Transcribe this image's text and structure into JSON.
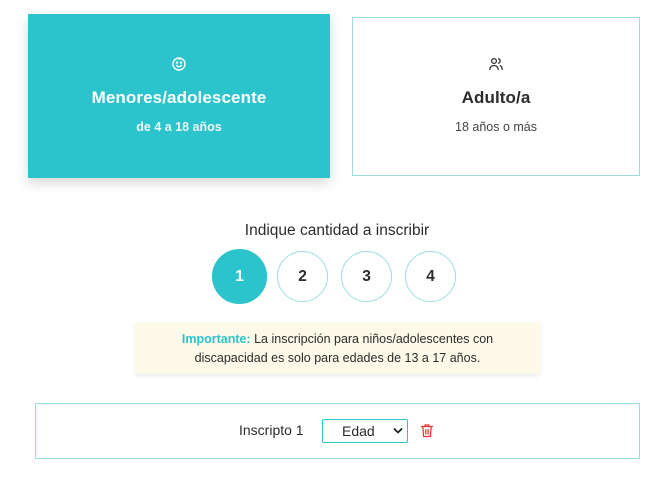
{
  "cards": {
    "minor": {
      "icon": "smiley-icon",
      "title": "Menores/adolescente",
      "subtitle": "de 4 a 18 años"
    },
    "adult": {
      "icon": "users-icon",
      "title": "Adulto/a",
      "subtitle": "18 años o más"
    }
  },
  "quantity": {
    "label": "Indique cantidad a inscribir",
    "options": [
      "1",
      "2",
      "3",
      "4"
    ],
    "selected": "1"
  },
  "notice": {
    "strong": "Importante:",
    "line1": "La inscripción para niños/adolescentes con",
    "line2": "discapacidad es solo para edades de 13 a 17 años."
  },
  "registrant": {
    "label": "Inscripto 1",
    "age_select_value": "Edad",
    "delete_icon": "trash-icon"
  },
  "colors": {
    "accent": "#2bc4cc",
    "border": "#9adde2",
    "notice_bg": "#fefaea",
    "danger": "#e53935"
  }
}
